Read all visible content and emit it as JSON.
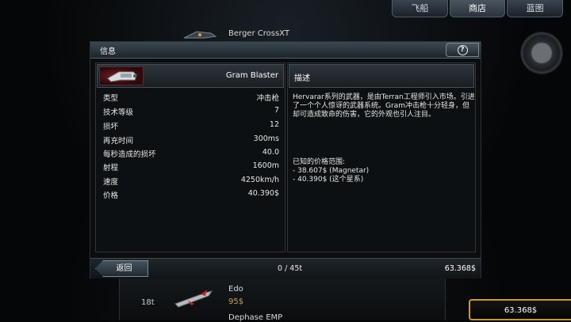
{
  "nav": {
    "tabs": [
      "飞船",
      "商店",
      "蓝图"
    ],
    "active_tab": "商店"
  },
  "background": {
    "top_item": {
      "name": "Berger CrossXT"
    },
    "row_item": {
      "count": "18t",
      "name": "Edo",
      "price": "95$"
    },
    "next_item": {
      "name": "Dephase EMP"
    },
    "credits": "63.368$"
  },
  "dialog": {
    "title": "信息",
    "help_icon": "question-icon",
    "weapon": {
      "name": "Gram Blaster",
      "icon": "weapon-icon"
    },
    "stats": [
      {
        "label": "类型",
        "value": "冲击枪"
      },
      {
        "label": "技术等级",
        "value": "7"
      },
      {
        "label": "损坏",
        "value": "12"
      },
      {
        "label": "再充时间",
        "value": "300ms"
      },
      {
        "label": "每秒造成的损坏",
        "value": "40.0"
      },
      {
        "label": "射程",
        "value": "1600m"
      },
      {
        "label": "速度",
        "value": "4250km/h"
      },
      {
        "label": "价格",
        "value": "40.390$"
      }
    ],
    "description": {
      "title": "描述",
      "body": "Hervarar系列的武器，是由Terran工程师引入市场。引进了一个个人惊讶的武器系统。Gram冲击枪十分轻身，但却可造成致命的伤害，它的外观也引人注目。",
      "price_heading": "已知的价格范围:",
      "price_lines": [
        "- 38.607$ (Magnetar)",
        "- 40.390$ (这个星系)"
      ]
    },
    "footer": {
      "back_label": "返回",
      "cargo": "0 / 45t",
      "credits": "63.368$"
    }
  },
  "colors": {
    "accent_gold": "#c99a2b",
    "weapon_red": "#7a1e24"
  }
}
